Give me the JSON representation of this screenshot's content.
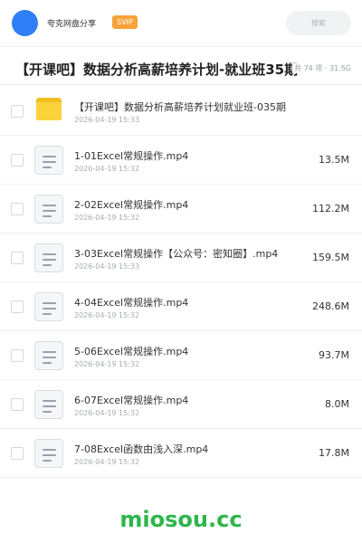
{
  "header": {
    "share_name": "夸克网盘分享",
    "badge": "SVIP",
    "search_placeholder": "搜索",
    "avatar_color": "#2f7ef5"
  },
  "folder": {
    "title": "【开课吧】数据分析高薪培养计划-就业班35期",
    "stats": "共 74 项 · 31.5G"
  },
  "items": [
    {
      "type": "folder",
      "icon": "folder-icon",
      "name": "【开课吧】数据分析高薪培养计划就业班-035期",
      "date": "2026-04-19 15:33",
      "size": ""
    },
    {
      "type": "file",
      "icon": "file-icon",
      "name": "1-01Excel常规操作.mp4",
      "date": "2026-04-19 15:32",
      "size": "13.5M"
    },
    {
      "type": "file",
      "icon": "file-icon",
      "name": "2-02Excel常规操作.mp4",
      "date": "2026-04-19 15:32",
      "size": "112.2M"
    },
    {
      "type": "file",
      "icon": "file-icon",
      "name": "3-03Excel常规操作【公众号：密知圈】.mp4",
      "date": "2026-04-19 15:33",
      "size": "159.5M"
    },
    {
      "type": "file",
      "icon": "file-icon",
      "name": "4-04Excel常规操作.mp4",
      "date": "2026-04-19 15:32",
      "size": "248.6M"
    },
    {
      "type": "file",
      "icon": "file-icon",
      "name": "5-06Excel常规操作.mp4",
      "date": "2026-04-19 15:32",
      "size": "93.7M"
    },
    {
      "type": "file",
      "icon": "file-icon",
      "name": "6-07Excel常规操作.mp4",
      "date": "2026-04-19 15:32",
      "size": "8.0M"
    },
    {
      "type": "file",
      "icon": "file-icon",
      "name": "7-08Excel函数由浅入深.mp4",
      "date": "2026-04-19 15:32",
      "size": "17.8M"
    }
  ],
  "watermark": "miosou.cc"
}
